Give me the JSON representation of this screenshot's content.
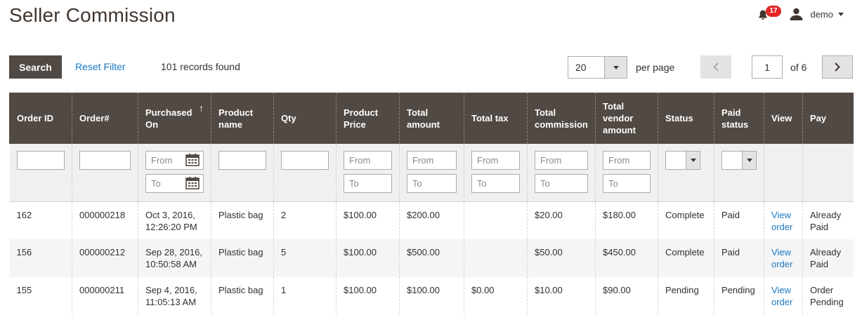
{
  "page": {
    "title": "Seller Commission"
  },
  "header": {
    "notifications_count": "17",
    "user_name": "demo"
  },
  "toolbar": {
    "search_label": "Search",
    "reset_filter_label": "Reset Filter",
    "records_found": "101 records found",
    "per_page_value": "20",
    "per_page_label": "per page",
    "current_page": "1",
    "of_pages": "of 6"
  },
  "columns": [
    "Order ID",
    "Order#",
    "Purchased On",
    "Product name",
    "Qty",
    "Product Price",
    "Total amount",
    "Total tax",
    "Total commission",
    "Total vendor amount",
    "Status",
    "Paid status",
    "View",
    "Pay"
  ],
  "sort_indicator": "↑",
  "filters": {
    "from_placeholder": "From",
    "to_placeholder": "To"
  },
  "rows": [
    {
      "order_id": "162",
      "order_no": "000000218",
      "purchased_date": "Oct 3, 2016,",
      "purchased_time": "12:26:20 PM",
      "product": "Plastic bag",
      "qty": "2",
      "price": "$100.00",
      "total": "$200.00",
      "tax": "",
      "commission": "$20.00",
      "vendor_amount": "$180.00",
      "status": "Complete",
      "paid_status": "Paid",
      "view": "View order",
      "pay": "Already Paid"
    },
    {
      "order_id": "156",
      "order_no": "000000212",
      "purchased_date": "Sep 28, 2016,",
      "purchased_time": "10:50:58 AM",
      "product": "Plastic bag",
      "qty": "5",
      "price": "$100.00",
      "total": "$500.00",
      "tax": "",
      "commission": "$50.00",
      "vendor_amount": "$450.00",
      "status": "Complete",
      "paid_status": "Paid",
      "view": "View order",
      "pay": "Already Paid"
    },
    {
      "order_id": "155",
      "order_no": "000000211",
      "purchased_date": "Sep 4, 2016,",
      "purchased_time": "11:05:13 AM",
      "product": "Plastic bag",
      "qty": "1",
      "price": "$100.00",
      "total": "$100.00",
      "tax": "$0.00",
      "commission": "$10.00",
      "vendor_amount": "$90.00",
      "status": "Pending",
      "paid_status": "Pending",
      "view": "View order",
      "pay": "Order Pending"
    }
  ],
  "colors": {
    "header_bg": "#514943",
    "link": "#1979c3",
    "badge": "#e22626",
    "filter_bg": "#f0f0f0"
  }
}
